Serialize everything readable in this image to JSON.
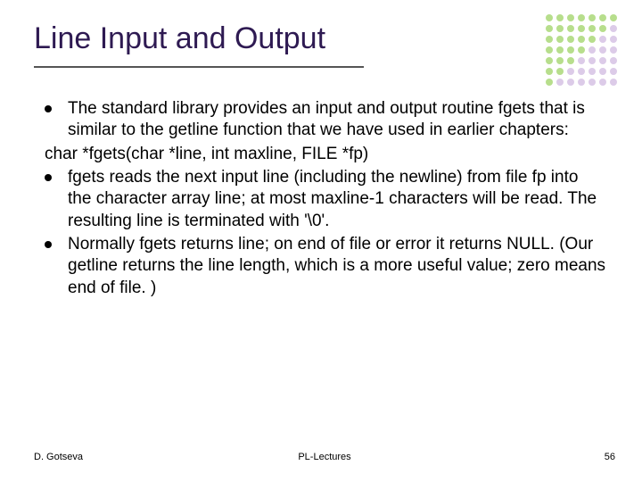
{
  "title": "Line Input and Output",
  "bullets": {
    "b1": "The standard library provides an input and output routine fgets that is similar to the getline function that we have used in earlier chapters:",
    "code": "char *fgets(char *line, int maxline, FILE *fp)",
    "b2": "fgets reads the next input line (including the newline) from file fp into the character array line; at most maxline-1 characters will be read. The resulting line is terminated with '\\0'.",
    "b3": "Normally fgets returns line; on end of file or error it returns NULL. (Our getline returns the line length, which is a more useful value; zero means end of file. )"
  },
  "footer": {
    "left": "D. Gotseva",
    "center": "PL-Lectures",
    "right": "56"
  },
  "dot_colors": [
    "#b7de8c",
    "#b7de8c",
    "#b7de8c",
    "#b7de8c",
    "#b7de8c",
    "#b7de8c",
    "#b7de8c",
    "#b7de8c",
    "#b7de8c",
    "#b7de8c",
    "#b7de8c",
    "#b7de8c",
    "#b7de8c",
    "#dccbe8",
    "#b7de8c",
    "#b7de8c",
    "#b7de8c",
    "#b7de8c",
    "#b7de8c",
    "#dccbe8",
    "#dccbe8",
    "#b7de8c",
    "#b7de8c",
    "#b7de8c",
    "#b7de8c",
    "#dccbe8",
    "#dccbe8",
    "#dccbe8",
    "#b7de8c",
    "#b7de8c",
    "#b7de8c",
    "#dccbe8",
    "#dccbe8",
    "#dccbe8",
    "#dccbe8",
    "#b7de8c",
    "#b7de8c",
    "#dccbe8",
    "#dccbe8",
    "#dccbe8",
    "#dccbe8",
    "#dccbe8",
    "#b7de8c",
    "#dccbe8",
    "#dccbe8",
    "#dccbe8",
    "#dccbe8",
    "#dccbe8",
    "#dccbe8"
  ]
}
